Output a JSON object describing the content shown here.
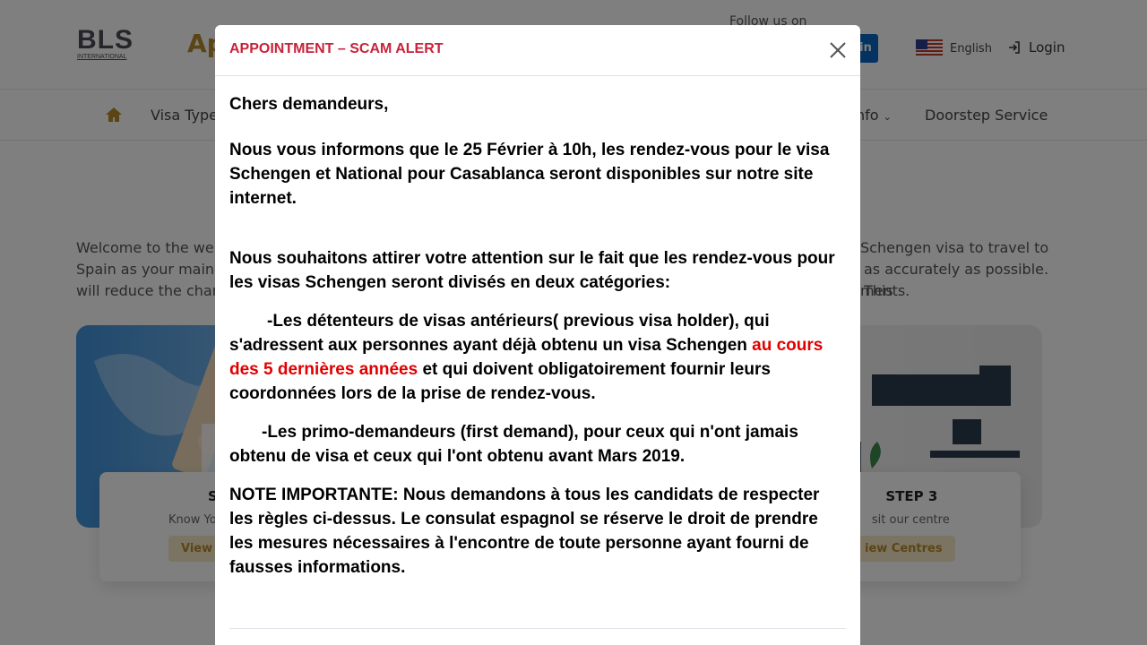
{
  "header": {
    "logo_text": "BLS",
    "logo_sub": "INTERNATIONAL",
    "site_title": "Ap",
    "follow_label": "Follow us on",
    "social_label": "in",
    "language": "English",
    "login": "Login"
  },
  "nav": {
    "items": [
      "Visa Type",
      "nfo",
      "Doorstep Service"
    ]
  },
  "welcome": {
    "line1_left": "Welcome to the webs",
    "line1_right": "Schengen visa to travel to",
    "line2_left": "Spain as your main ce",
    "line2_right": "as accurately as possible. This",
    "line3_left": "will reduce the chanc",
    "line3_right": "ments."
  },
  "steps": {
    "step1_title": "S",
    "step1_sub": "Know Yo",
    "step1_btn": "View",
    "step3_title": "STEP 3",
    "step3_sub": "sit our centre",
    "step3_btn": "iew Centres"
  },
  "modal": {
    "title": "APPOINTMENT – SCAM ALERT",
    "greeting": "Chers demandeurs,",
    "para1": "Nous vous informons que le 25 Février à 10h, les rendez-vous pour le visa Schengen et National pour Casablanca seront disponibles sur notre site internet.",
    "para2": "Nous souhaitons attirer votre attention sur le fait que les rendez-vous pour les visas Schengen seront divisés en deux catégories:",
    "para3_indent": "        ",
    "para3_a": "-Les détenteurs de visas antérieurs( previous visa holder), qui s'adressent aux personnes ayant déjà obtenu un visa Schengen  ",
    "para3_red": "au cours des 5 dernières années",
    "para3_b": " et qui doivent obligatoirement fournir leurs coordonnées lors de la prise de rendez-vous.",
    "para4": "-Les primo-demandeurs (first demand), pour ceux qui n'ont jamais obtenu de visa et ceux qui l'ont obtenu avant Mars 2019.",
    "para5": "NOTE IMPORTANTE: Nous demandons à tous les candidats de respecter les règles ci-dessus. Le consulat espagnol se réserve le droit de prendre les mesures nécessaires à l'encontre de toute personne ayant fourni de fausses informations."
  },
  "colors": {
    "alert_title": "#c8233a",
    "highlight_red": "#e00000",
    "brand_gold": "#b58a2a"
  }
}
